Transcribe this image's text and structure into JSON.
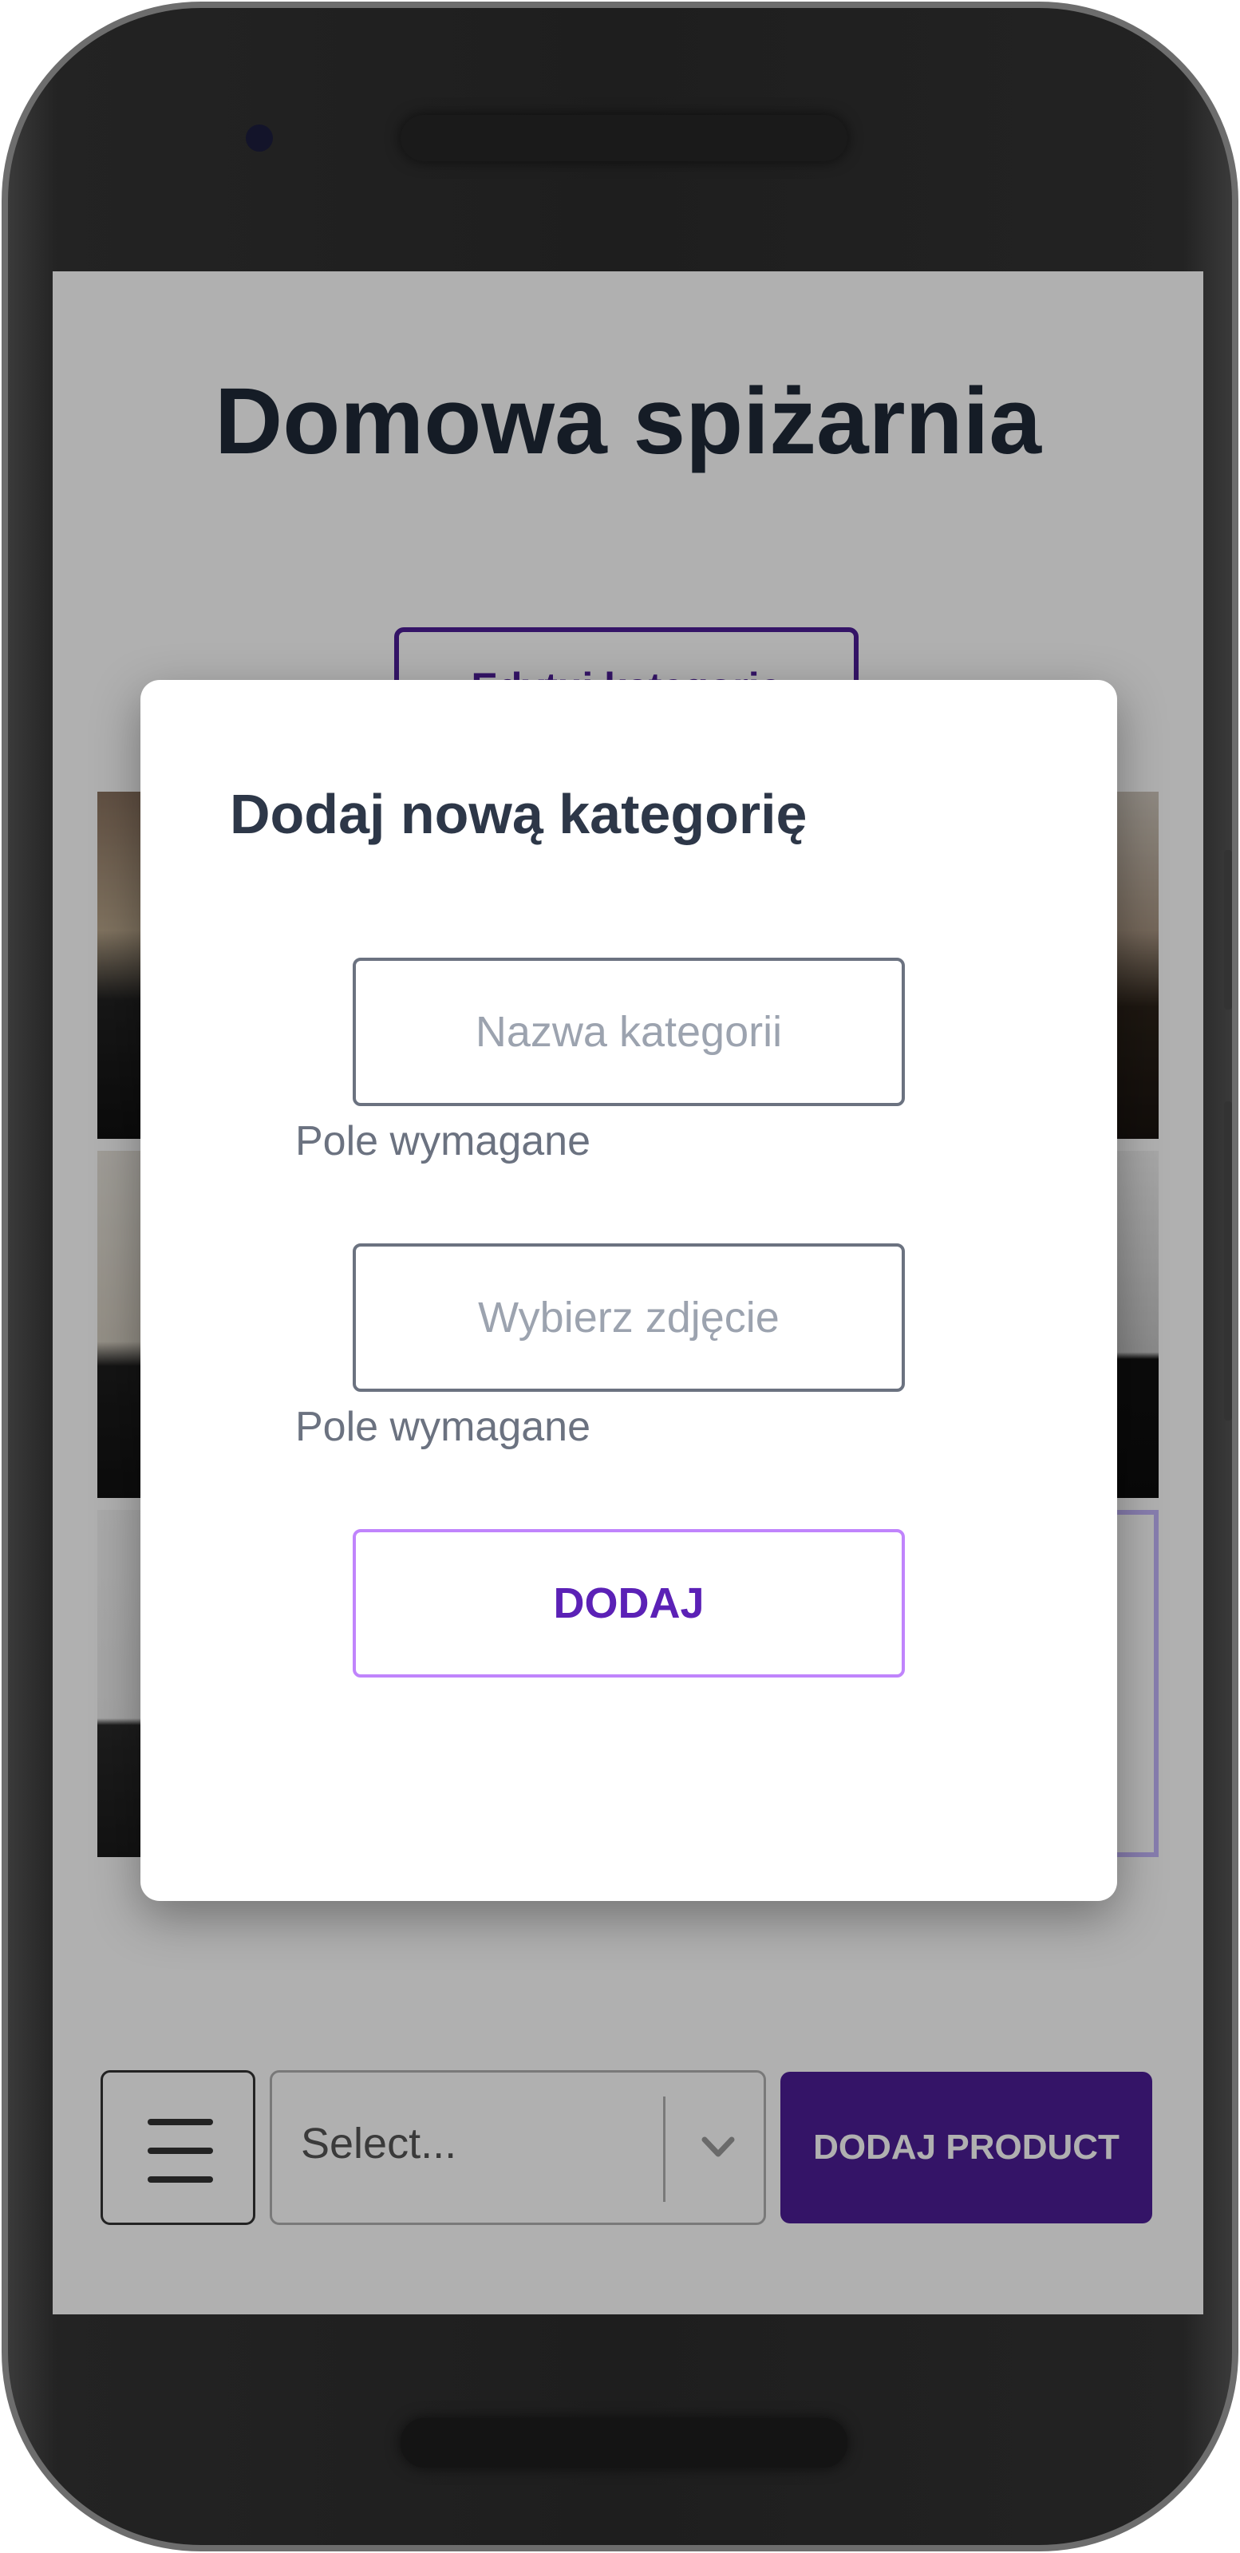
{
  "app": {
    "title": "Domowa spiżarnia",
    "edit_button_label": "Edytuj kategorie"
  },
  "toolbar": {
    "select_placeholder": "Select...",
    "add_product_label": "DODAJ PRODUCT"
  },
  "modal": {
    "title": "Dodaj nową kategorię",
    "name_placeholder": "Nazwa kategorii",
    "name_helper": "Pole wymagane",
    "image_placeholder": "Wybierz zdjęcie",
    "image_helper": "Pole wymagane",
    "submit_label": "DODAJ"
  },
  "icons": {
    "menu": "hamburger-icon",
    "select_arrow": "chevron-down-icon"
  },
  "colors": {
    "accent": "#4c1d95",
    "submit_border": "#c084fc",
    "overlay": "rgba(0,0,0,0.31)"
  }
}
